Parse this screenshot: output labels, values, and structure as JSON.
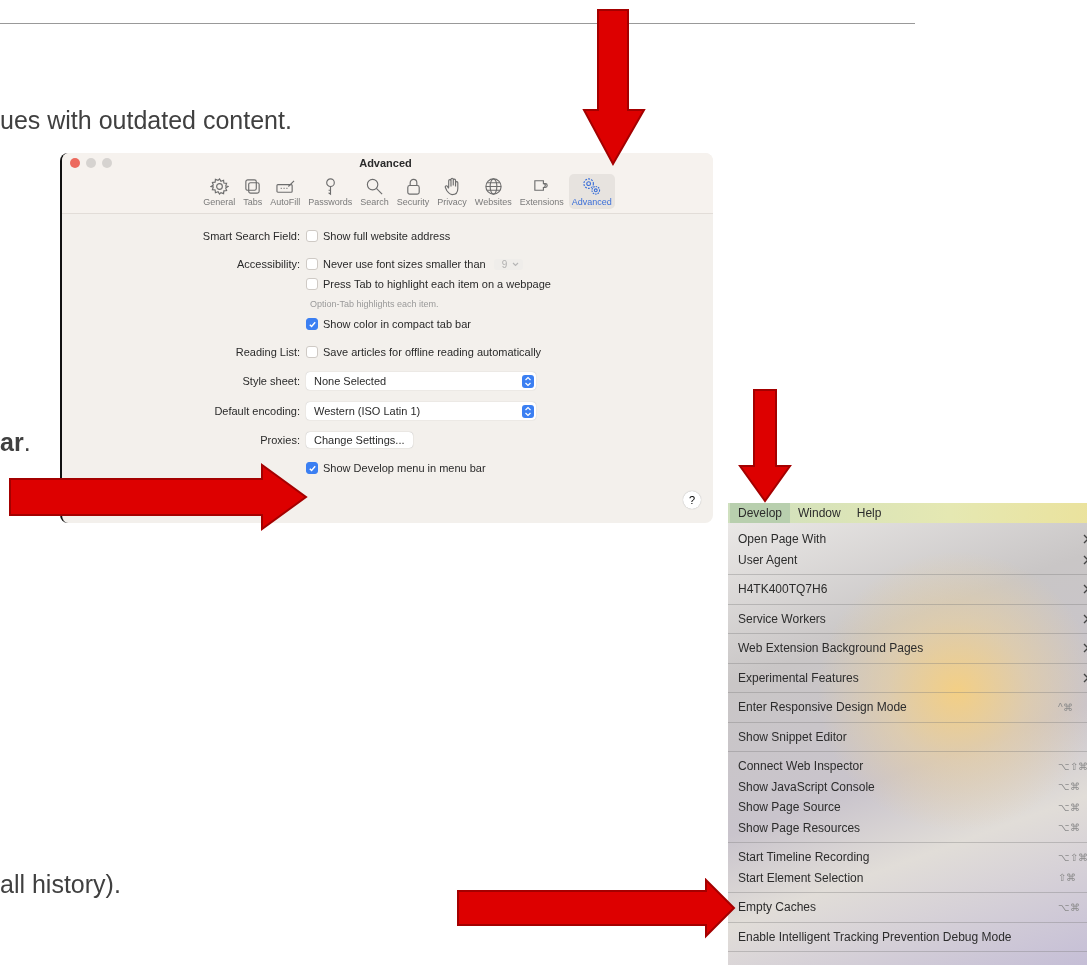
{
  "paragraph_fragments": [
    "ues with outdated content.",
    "**ar**.",
    "all history)."
  ],
  "settings_window": {
    "title": "Advanced",
    "tabs": [
      {
        "label": "General",
        "selected": false
      },
      {
        "label": "Tabs",
        "selected": false
      },
      {
        "label": "AutoFill",
        "selected": false
      },
      {
        "label": "Passwords",
        "selected": false
      },
      {
        "label": "Search",
        "selected": false
      },
      {
        "label": "Security",
        "selected": false
      },
      {
        "label": "Privacy",
        "selected": false
      },
      {
        "label": "Websites",
        "selected": false
      },
      {
        "label": "Extensions",
        "selected": false
      },
      {
        "label": "Advanced",
        "selected": true
      }
    ],
    "groups": [
      [
        {
          "kind": "checkbox",
          "label": "Smart Search Field:",
          "text": "Show full website address",
          "checked": false
        }
      ],
      [
        {
          "kind": "checkbox",
          "label": "Accessibility:",
          "text": "Never use font sizes smaller than",
          "checked": false,
          "popup": "9"
        },
        {
          "kind": "checkbox",
          "text": "Press Tab to highlight each item on a webpage",
          "checked": false
        },
        {
          "kind": "note",
          "text": "Option-Tab highlights each item."
        },
        {
          "kind": "checkbox",
          "text": "Show color in compact tab bar",
          "checked": true
        }
      ],
      [
        {
          "kind": "checkbox",
          "label": "Reading List:",
          "text": "Save articles for offline reading automatically",
          "checked": false
        }
      ],
      [
        {
          "kind": "dropdown",
          "label": "Style sheet:",
          "value": "None Selected"
        }
      ],
      [
        {
          "kind": "dropdown",
          "label": "Default encoding:",
          "value": "Western (ISO Latin 1)"
        }
      ],
      [
        {
          "kind": "button",
          "label": "Proxies:",
          "text": "Change Settings..."
        }
      ],
      [
        {
          "kind": "checkbox",
          "text": "Show Develop menu in menu bar",
          "checked": true
        }
      ]
    ],
    "help_button": "?"
  },
  "develop_menu": {
    "menubar": [
      {
        "label": "Develop",
        "selected": true
      },
      {
        "label": "Window",
        "selected": false
      },
      {
        "label": "Help",
        "selected": false
      }
    ],
    "sections": [
      [
        {
          "label": "Open Page With",
          "submenu": true
        },
        {
          "label": "User Agent",
          "submenu": true
        }
      ],
      [
        {
          "label": "H4TK400TQ7H6",
          "submenu": true
        }
      ],
      [
        {
          "label": "Service Workers",
          "submenu": true
        }
      ],
      [
        {
          "label": "Web Extension Background Pages",
          "submenu": true
        }
      ],
      [
        {
          "label": "Experimental Features",
          "submenu": true
        }
      ],
      [
        {
          "label": "Enter Responsive Design Mode",
          "submenu": false,
          "shortcut": "^⌘"
        }
      ],
      [
        {
          "label": "Show Snippet Editor",
          "submenu": false
        }
      ],
      [
        {
          "label": "Connect Web Inspector",
          "submenu": false,
          "shortcut": "⌥⇧⌘"
        },
        {
          "label": "Show JavaScript Console",
          "submenu": false,
          "shortcut": "⌥⌘"
        },
        {
          "label": "Show Page Source",
          "submenu": false,
          "shortcut": "⌥⌘"
        },
        {
          "label": "Show Page Resources",
          "submenu": false,
          "shortcut": "⌥⌘"
        }
      ],
      [
        {
          "label": "Start Timeline Recording",
          "submenu": false,
          "shortcut": "⌥⇧⌘"
        },
        {
          "label": "Start Element Selection",
          "submenu": false,
          "shortcut": "⇧⌘"
        }
      ],
      [
        {
          "label": "Empty Caches",
          "submenu": false,
          "shortcut": "⌥⌘"
        }
      ],
      [
        {
          "label": "Enable Intelligent Tracking Prevention Debug Mode",
          "submenu": false
        }
      ]
    ]
  }
}
